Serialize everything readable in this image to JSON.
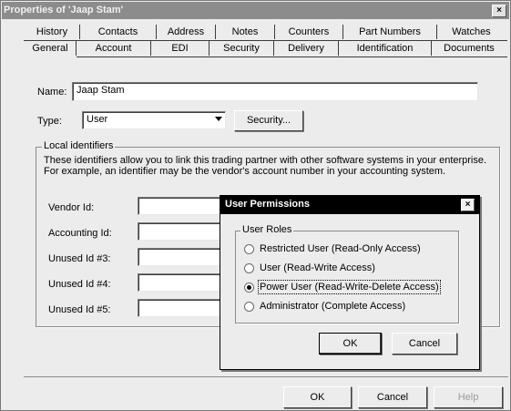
{
  "window": {
    "title": "Properties of 'Jaap Stam'",
    "close_glyph": "×"
  },
  "tabs": {
    "row1": [
      "History",
      "Contacts",
      "Address",
      "Notes",
      "Counters",
      "Part Numbers",
      "Watches"
    ],
    "row2": [
      "General",
      "Account",
      "EDI",
      "Security",
      "Delivery",
      "Identification",
      "Documents"
    ],
    "active": "General"
  },
  "form": {
    "name_label": "Name:",
    "name_value": "Jaap Stam",
    "type_label": "Type:",
    "type_value": "User",
    "security_button": "Security..."
  },
  "local_identifiers": {
    "title": "Local identifiers",
    "description": "These identifiers allow you to link this trading partner with other software systems in your enterprise. For example, an identifier may be the vendor's account number in your accounting system.",
    "fields": [
      "Vendor Id:",
      "Accounting Id:",
      "Unused Id #3:",
      "Unused Id #4:",
      "Unused Id #5:"
    ]
  },
  "buttons": {
    "ok": "OK",
    "cancel": "Cancel",
    "help": "Help"
  },
  "user_permissions": {
    "title": "User Permissions",
    "close_glyph": "×",
    "group_title": "User Roles",
    "roles": [
      {
        "label": "Restricted User (Read-Only Access)",
        "selected": false
      },
      {
        "label": "User (Read-Write Access)",
        "selected": false
      },
      {
        "label": "Power User (Read-Write-Delete Access)",
        "selected": true
      },
      {
        "label": "Administrator (Complete Access)",
        "selected": false
      }
    ],
    "ok": "OK",
    "cancel": "Cancel"
  }
}
